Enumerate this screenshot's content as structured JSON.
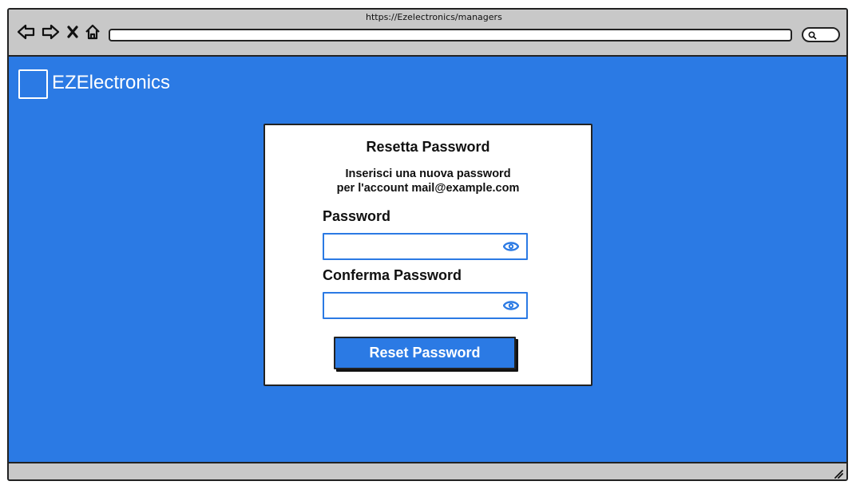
{
  "browser": {
    "url": "https://Ezelectronics/managers",
    "icons": [
      "back-arrow-icon",
      "forward-arrow-icon",
      "close-icon",
      "home-icon",
      "search-icon",
      "resize-grip-icon"
    ]
  },
  "app": {
    "name": "EZElectronics"
  },
  "reset_form": {
    "title": "Resetta Password",
    "subtitle_line1": "Inserisci una nuova password",
    "subtitle_line2": "per l'account mail@example.com",
    "password_label": "Password",
    "password_value": "",
    "confirm_label": "Conferma Password",
    "confirm_value": "",
    "submit_label": "Reset Password"
  },
  "colors": {
    "accent": "#2b7ae4",
    "chrome": "#c8c8c8",
    "card": "#ffffff",
    "text": "#111111"
  }
}
